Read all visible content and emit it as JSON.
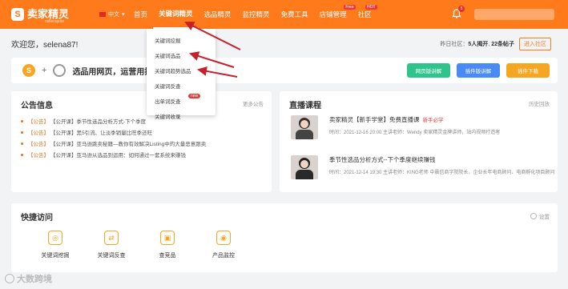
{
  "nav": {
    "brand": "卖家精灵",
    "brand_sub": "sellersprite",
    "lang": "中文",
    "items": [
      {
        "label": "首页"
      },
      {
        "label": "关键词精灵"
      },
      {
        "label": "选品精灵"
      },
      {
        "label": "监控精灵"
      },
      {
        "label": "免费工具"
      },
      {
        "label": "店铺管理"
      },
      {
        "label": "社区"
      }
    ],
    "free_tag": "Free",
    "hot_tag": "HOT",
    "notif_count": "5"
  },
  "welcome": {
    "greeting": "欢迎您，selena87!",
    "community_prefix": "昨日社区：",
    "joined": "5人揭开",
    "posts": "22条帖子",
    "enter_btn": "进入社区"
  },
  "promo": {
    "text": "选品用网页，运营用插件",
    "buttons": [
      {
        "label": "网页版讲解",
        "color": "#2ec48c"
      },
      {
        "label": "插件版讲解",
        "color": "#4a8af4"
      },
      {
        "label": "插件下载",
        "color": "#f5a623"
      }
    ]
  },
  "dropdown": {
    "items": [
      {
        "label": "关键词挖掘"
      },
      {
        "label": "关键词选品"
      },
      {
        "label": "关键词趋势选品"
      },
      {
        "label": "关键词反查"
      },
      {
        "label": "出单词反查"
      },
      {
        "label": "关键词收录"
      }
    ],
    "new_tag": "new"
  },
  "notices": {
    "title": "公告信息",
    "more": "更多公告",
    "items": [
      {
        "tag": "【公告】",
        "text": "【公开课】季节性选品分析方式-下个季度"
      },
      {
        "tag": "【公告】",
        "text": "【公开课】黑5引流、让淡季销量比旺季还旺"
      },
      {
        "tag": "【公告】",
        "text": "【公开课】亚马逊跳卖秘籍—教你有效解决Listing中的大量恶意跟卖"
      },
      {
        "tag": "【公告】",
        "text": "【公开课】亚马逊从选品到运用：如何通过一套系统来赚钱"
      }
    ]
  },
  "live": {
    "title": "直播课程",
    "more": "历史回放",
    "items": [
      {
        "title": "卖家精灵【新手学堂】免费直播课",
        "badge": "新手必学",
        "meta": "时间：2021-12-16 20:00    主讲老师：Wendy  卖家精灵金牌讲师，站内视频打造者"
      },
      {
        "title": "季节性选品分析方式--下个季度继续赚钱",
        "badge": "",
        "meta": "时间：2021-12-14 19:30    主讲老师：KING老师  中晨信商字院院长，企业长年电商顾问、电商孵化项目顾问"
      }
    ]
  },
  "quick": {
    "title": "快捷访问",
    "settings": "设置",
    "items": [
      {
        "label": "关键词挖掘",
        "icon": "keyword-mining-icon"
      },
      {
        "label": "关键词反查",
        "icon": "keyword-reverse-icon"
      },
      {
        "label": "查竞品",
        "icon": "competitor-icon"
      },
      {
        "label": "产品监控",
        "icon": "product-monitor-icon"
      }
    ]
  },
  "watermark": "大数跨境",
  "colors": {
    "brand_orange": "#ff7a1a",
    "background": "#f2f3f5",
    "arrow_red": "#c8202a"
  }
}
